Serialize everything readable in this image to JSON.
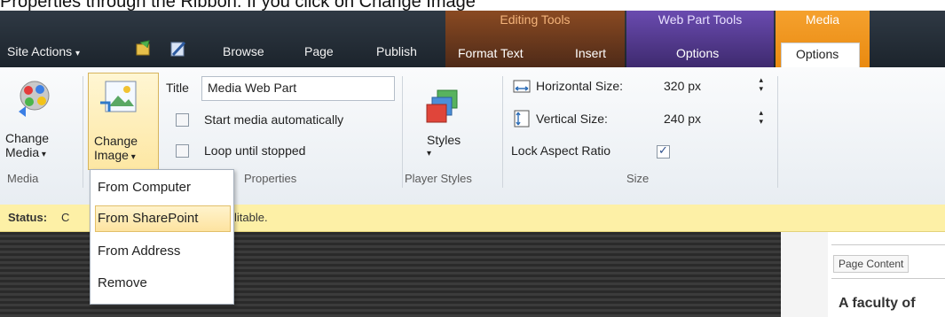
{
  "caption": {
    "prefix": "Properties through the Ribbon. If you click on Change Image",
    "bold": "Change Image"
  },
  "ribbon": {
    "site_actions": "Site Actions",
    "tabs": [
      "Browse",
      "Page",
      "Publish"
    ],
    "contexts": [
      {
        "title": "Editing Tools",
        "tabs": [
          "Format Text",
          "Insert"
        ]
      },
      {
        "title": "Web Part Tools",
        "tabs": [
          "Options"
        ]
      },
      {
        "title": "Media",
        "tabs": [
          "Options"
        ]
      }
    ]
  },
  "groups": {
    "media": {
      "label": "Media",
      "change_media_line1": "Change",
      "change_media_line2": "Media"
    },
    "change_image": {
      "line1": "Change",
      "line2": "Image"
    },
    "properties": {
      "label": "Properties",
      "title_label": "Title",
      "title_value": "Media Web Part",
      "start_auto": "Start media automatically",
      "loop": "Loop until stopped"
    },
    "player_styles": {
      "label": "Player Styles",
      "styles": "Styles"
    },
    "size": {
      "label": "Size",
      "horizontal_label": "Horizontal Size:",
      "horizontal_value": "320 px",
      "vertical_label": "Vertical Size:",
      "vertical_value": "240 px",
      "lock_label": "Lock Aspect Ratio",
      "lock_checked": true
    }
  },
  "status": {
    "label": "Status:",
    "text_prefix": "C",
    "text_suffix": "litable."
  },
  "menu": {
    "items": [
      "From Computer",
      "From SharePoint",
      "From Address",
      "Remove"
    ],
    "highlighted_index": 1
  },
  "right_panel": {
    "tab": "Page Content",
    "heading": "A faculty of"
  },
  "colors": {
    "editing_tools": "#7a3b17",
    "web_part_tools": "#4a2a7a",
    "media": "#f08a16",
    "status_bg": "#fdf0a6"
  }
}
